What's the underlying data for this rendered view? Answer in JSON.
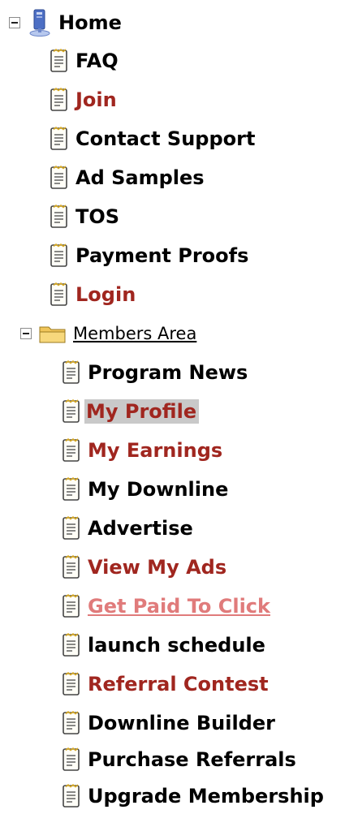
{
  "tree": {
    "home": {
      "label": "Home",
      "icon": "home-computer-icon"
    },
    "home_items": [
      {
        "label": "FAQ",
        "style": "normal",
        "icon": "page-icon"
      },
      {
        "label": "Join",
        "style": "red",
        "icon": "page-icon"
      },
      {
        "label": "Contact Support",
        "style": "normal",
        "icon": "page-icon"
      },
      {
        "label": "Ad Samples",
        "style": "normal",
        "icon": "page-icon"
      },
      {
        "label": "TOS",
        "style": "normal",
        "icon": "page-icon"
      },
      {
        "label": "Payment Proofs",
        "style": "normal",
        "icon": "page-icon"
      },
      {
        "label": "Login",
        "style": "red",
        "icon": "page-icon"
      }
    ],
    "members": {
      "label": "Members Area",
      "icon": "folder-icon"
    },
    "member_items": [
      {
        "label": "Program News",
        "style": "normal",
        "icon": "page-icon"
      },
      {
        "label": "My Profile",
        "style": "red selected",
        "icon": "page-icon"
      },
      {
        "label": "My Earnings",
        "style": "red",
        "icon": "page-icon"
      },
      {
        "label": "My Downline",
        "style": "normal",
        "icon": "page-icon"
      },
      {
        "label": "Advertise",
        "style": "normal",
        "icon": "page-icon"
      },
      {
        "label": "View My Ads",
        "style": "red",
        "icon": "page-icon"
      },
      {
        "label": "Get Paid To Click",
        "style": "underlined link",
        "icon": "page-icon"
      },
      {
        "label": "launch schedule",
        "style": "normal",
        "icon": "page-icon"
      },
      {
        "label": "Referral Contest",
        "style": "red",
        "icon": "page-icon"
      },
      {
        "label": "Downline Builder",
        "style": "normal",
        "icon": "page-icon"
      },
      {
        "label": "Purchase Referrals",
        "style": "normal",
        "icon": "page-icon"
      },
      {
        "label": "Upgrade Membership",
        "style": "normal",
        "icon": "page-icon"
      }
    ],
    "colors": {
      "red": "#a0261f",
      "link": "#e07b7b",
      "selected_bg": "#c9c9c9",
      "black": "#000000"
    }
  }
}
